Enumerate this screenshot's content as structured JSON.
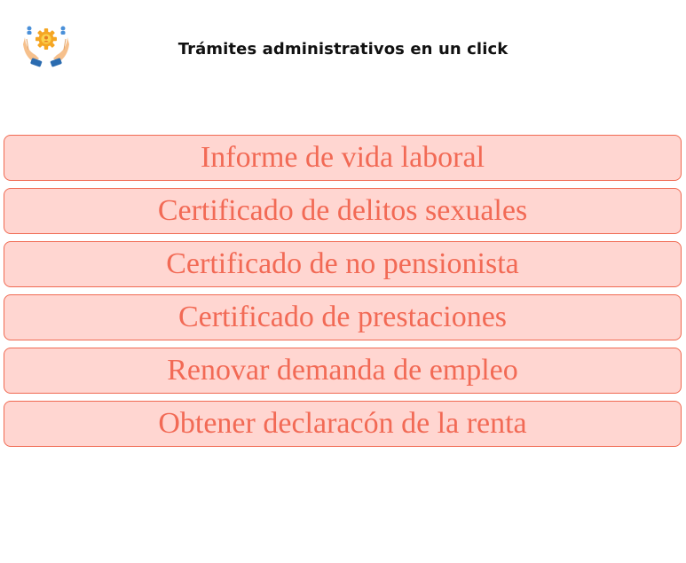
{
  "header": {
    "title": "Trámites administrativos en un click",
    "logo_icon": "hands-holding-gear-with-people-icon"
  },
  "options": [
    {
      "label": "Informe de vida laboral"
    },
    {
      "label": "Certificado de delitos sexuales"
    },
    {
      "label": "Certificado de no pensionista"
    },
    {
      "label": "Certificado de prestaciones"
    },
    {
      "label": "Renovar demanda de empleo"
    },
    {
      "label": "Obtener declaracón de la renta"
    }
  ],
  "colors": {
    "button_background": "#ffd6d1",
    "button_border": "#f06a52",
    "button_text": "#f26a55",
    "title_text": "#111111"
  }
}
